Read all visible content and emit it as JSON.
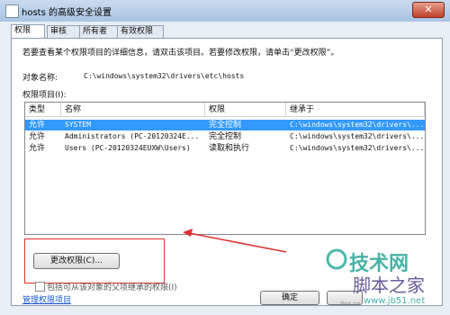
{
  "window": {
    "title": "hosts 的高级安全设置",
    "close": "✕"
  },
  "tabs": [
    "权限",
    "审核",
    "所有者",
    "有效权限"
  ],
  "instruction": "若要查看某个权限项目的详细信息，请双击该项目。若要修改权限，请单击“更改权限”。",
  "object_label": "对象名称:",
  "object_value": "C:\\windows\\system32\\drivers\\etc\\hosts",
  "entries_label": "权限项目(I):",
  "columns": [
    "类型",
    "名称",
    "权限",
    "继承于"
  ],
  "rows": [
    {
      "type": "允许",
      "name": "SYSTEM",
      "perm": "完全控制",
      "inherit": "C:\\windows\\system32\\drivers\\..."
    },
    {
      "type": "允许",
      "name": "Administrators (PC-20120324E...",
      "perm": "完全控制",
      "inherit": "C:\\windows\\system32\\drivers\\..."
    },
    {
      "type": "允许",
      "name": "Users (PC-20120324EUXW\\Users)",
      "perm": "读取和执行",
      "inherit": "C:\\windows\\system32\\drivers\\..."
    }
  ],
  "change_button": "更改权限(C)...",
  "checkbox_label": "包括可从该对象的父项继承的权限(I)",
  "manage_link": "管理权限项目",
  "ok_button": "确定",
  "watermark": {
    "top": "技术网",
    "bottom": "脚本之家",
    "url": "www.jb51.net",
    "side": "itss.cn"
  },
  "colors": {
    "accent": "#3399ff",
    "highlight_box": "#e03030"
  }
}
